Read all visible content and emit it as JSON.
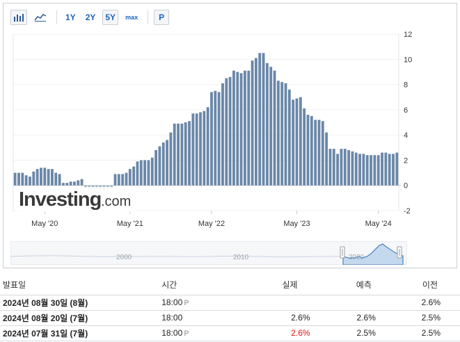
{
  "toolbar": {
    "bar_icon": "bar-chart-icon",
    "line_icon": "line-chart-icon",
    "ranges": [
      "1Y",
      "2Y",
      "5Y",
      "max"
    ],
    "active_range": "5Y",
    "p_button": "P"
  },
  "watermark": {
    "brand": "Investing",
    "suffix": ".com"
  },
  "chart_data": {
    "type": "bar",
    "x_tick_labels": [
      "May '20",
      "May '21",
      "May '22",
      "May '23",
      "May '24"
    ],
    "y_ticks": [
      -2,
      0,
      2,
      4,
      6,
      8,
      10,
      12
    ],
    "ylim": [
      -2,
      12
    ],
    "bar_color": "#6a87a8",
    "values": [
      1.0,
      1.0,
      1.0,
      0.8,
      0.7,
      1.1,
      1.3,
      1.4,
      1.4,
      1.3,
      1.3,
      1.0,
      0.9,
      0.2,
      0.2,
      0.3,
      0.3,
      0.4,
      0.5,
      -0.2,
      -0.3,
      -0.3,
      -0.3,
      -0.3,
      -0.3,
      -0.3,
      -0.3,
      0.9,
      0.9,
      0.9,
      1.0,
      1.3,
      1.5,
      1.9,
      2.0,
      2.0,
      2.0,
      2.2,
      2.8,
      3.1,
      3.4,
      3.6,
      4.2,
      4.9,
      4.9,
      4.9,
      5.0,
      5.1,
      5.7,
      5.7,
      5.8,
      5.9,
      6.2,
      7.4,
      7.5,
      7.4,
      8.1,
      8.5,
      8.6,
      9.1,
      9.0,
      8.9,
      9.1,
      9.1,
      9.9,
      10.1,
      10.5,
      10.5,
      9.7,
      9.4,
      9.1,
      8.3,
      8.2,
      8.1,
      7.6,
      6.8,
      6.9,
      7.0,
      6.1,
      5.6,
      5.5,
      5.2,
      5.2,
      5.1,
      4.2,
      2.9,
      2.9,
      2.5,
      2.9,
      2.9,
      2.8,
      2.7,
      2.6,
      2.5,
      2.5,
      2.4,
      2.4,
      2.4,
      2.4,
      2.6,
      2.6,
      2.5,
      2.5,
      2.6
    ]
  },
  "navigator": {
    "labels": [
      "2000",
      "2010",
      "2020"
    ]
  },
  "table": {
    "headers": [
      "발표일",
      "시간",
      "실제",
      "예측",
      "이전"
    ],
    "rows": [
      {
        "date": "2024년 08월 30일 (8월)",
        "time": "18:00",
        "pref": "P",
        "actual": "",
        "forecast": "",
        "previous": "2.6%"
      },
      {
        "date": "2024년 08월 20일 (7월)",
        "time": "18:00",
        "pref": "",
        "actual": "2.6%",
        "forecast": "2.6%",
        "previous": "2.5%"
      },
      {
        "date": "2024년 07월 31일 (7월)",
        "time": "18:00",
        "pref": "P",
        "actual": "2.6%",
        "forecast": "2.5%",
        "previous": "2.5%"
      }
    ],
    "negative_color": "#e01010"
  }
}
